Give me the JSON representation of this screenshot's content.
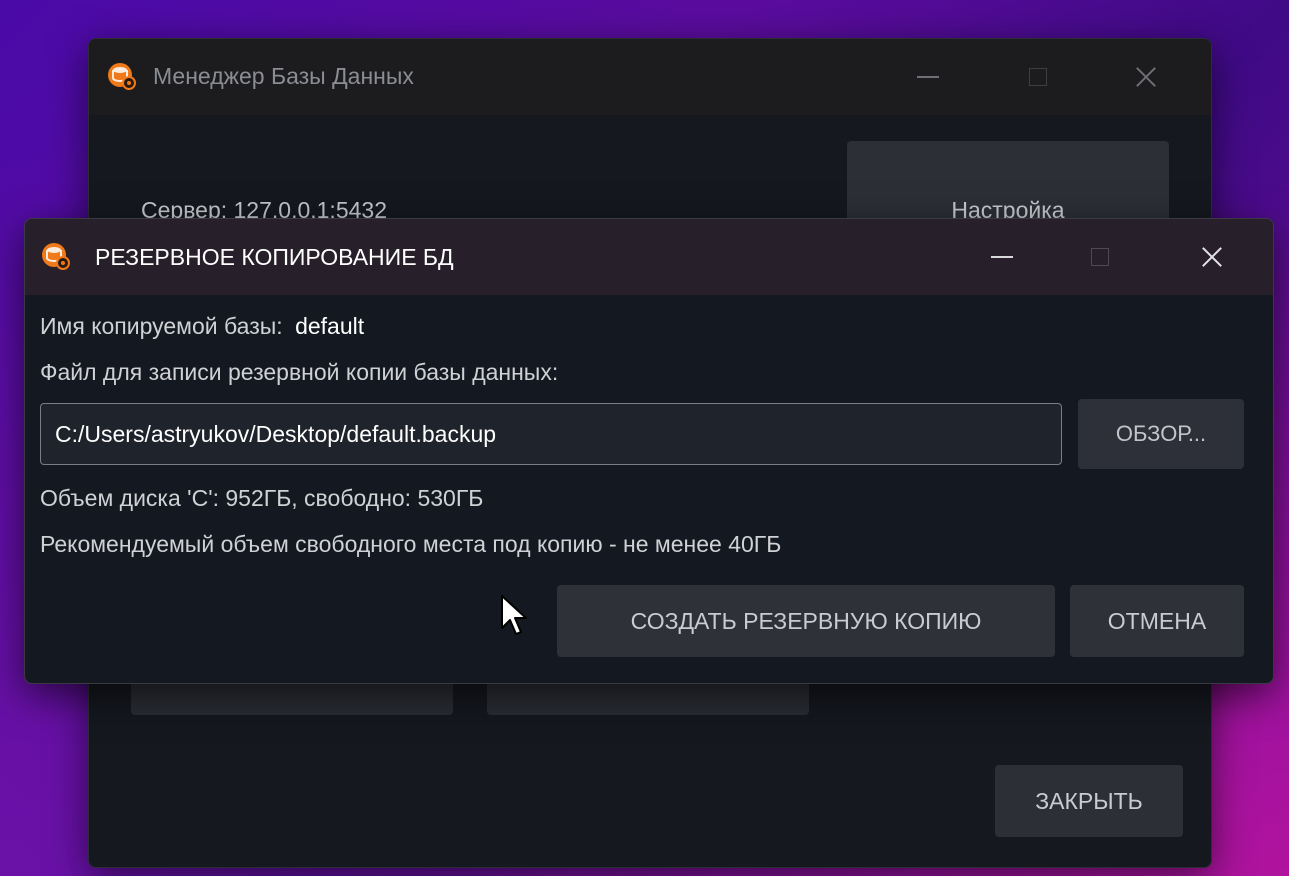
{
  "main_window": {
    "title": "Менеджер Базы Данных",
    "server_label": "Сервер: 127.0.0.1:5432",
    "settings_button": "Настройка",
    "close_button": "ЗАКРЫТЬ"
  },
  "backup_dialog": {
    "title": "РЕЗЕРВНОЕ КОПИРОВАНИЕ БД",
    "db_name_label": "Имя копируемой базы:",
    "db_name_value": "default",
    "file_label": "Файл для записи резервной копии базы данных:",
    "file_path": "C:/Users/astryukov/Desktop/default.backup",
    "browse_button": "ОБЗОР...",
    "disk_info": "Объем диска 'C': 952ГБ, свободно: 530ГБ",
    "recommendation": "Рекомендуемый объем свободного места под копию - не менее 40ГБ",
    "create_button": "СОЗДАТЬ РЕЗЕРВНУЮ КОПИЮ",
    "cancel_button": "ОТМЕНА"
  },
  "icons": {
    "app": "database-backup-app-icon",
    "minimize": "minimize-icon",
    "maximize": "maximize-icon",
    "close": "close-icon",
    "cursor": "mouse-pointer-icon"
  },
  "colors": {
    "accent": "#f07a1a",
    "dialog_titlebar": "#27202a",
    "window_bg": "#15181f"
  }
}
